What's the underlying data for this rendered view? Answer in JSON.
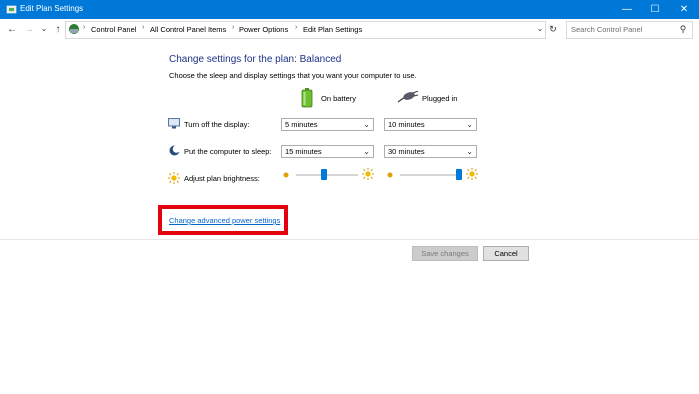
{
  "window": {
    "title": "Edit Plan Settings",
    "minimize_glyph": "—",
    "maximize_glyph": "☐",
    "close_glyph": "✕",
    "accent": "#0078d7"
  },
  "nav": {
    "back_glyph": "←",
    "forward_glyph": "→",
    "recent_glyph": "⌄",
    "up_glyph": "↑",
    "breadcrumbs": [
      "Control Panel",
      "All Control Panel Items",
      "Power Options",
      "Edit Plan Settings"
    ],
    "separator": "›",
    "dropdown_glyph": "⌄",
    "refresh_glyph": "↻",
    "search_placeholder": "Search Control Panel",
    "search_glyph": "⚲"
  },
  "main": {
    "heading": "Change settings for the plan: Balanced",
    "subtext": "Choose the sleep and display settings that you want your computer to use.",
    "columns": {
      "battery": "On battery",
      "plugged": "Plugged in"
    },
    "rows": {
      "display": {
        "label": "Turn off the display:",
        "battery": "5 minutes",
        "plugged": "10 minutes"
      },
      "sleep": {
        "label": "Put the computer to sleep:",
        "battery": "15 minutes",
        "plugged": "30 minutes"
      },
      "brightness": {
        "label": "Adjust plan brightness:",
        "battery_level": 0.45,
        "plugged_level": 0.95
      }
    },
    "chevron": "⌄",
    "advanced_link": "Change advanced power settings",
    "highlight_color": "#e3000f"
  },
  "footer": {
    "save": "Save changes",
    "cancel": "Cancel"
  }
}
